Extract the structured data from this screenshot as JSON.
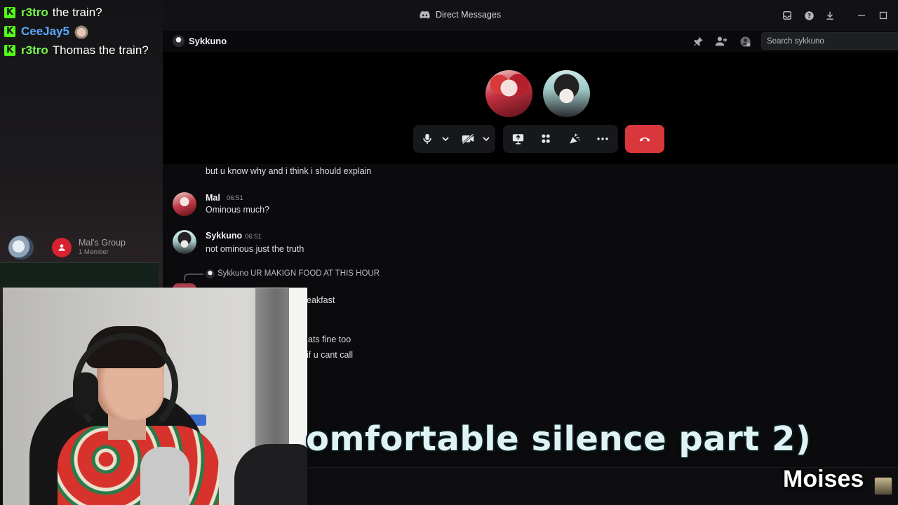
{
  "stream_chat": [
    {
      "badge": "K",
      "user": "r3tro",
      "user_color": "#75fb4c",
      "message": "the train?"
    },
    {
      "badge": "K",
      "user": "CeeJay5",
      "user_color": "#5aa8ff",
      "message": "",
      "emote": "cat-emote"
    },
    {
      "badge": "K",
      "user": "r3tro",
      "user_color": "#75fb4c",
      "message": "Thomas the train?"
    }
  ],
  "group": {
    "name": "Mal's Group",
    "members": "1 Member"
  },
  "window": {
    "title": "Direct Messages"
  },
  "dm_header": {
    "name": "Sykkuno",
    "search_placeholder": "Search sykkuno"
  },
  "icons": {
    "titlebar": [
      "inbox-icon",
      "help-icon",
      "download-icon",
      "minimize-icon",
      "maximize-icon"
    ],
    "header": [
      "pin-icon",
      "add-friend-icon",
      "profile-icon"
    ],
    "call": [
      "microphone-icon",
      "camera-off-icon",
      "screen-share-icon",
      "activity-icon",
      "soundboard-icon",
      "more-icon",
      "end-call-icon"
    ]
  },
  "colors": {
    "end_call": "#da373c",
    "kick_green": "#53fc18",
    "group_red": "#d6222e"
  },
  "messages": [
    {
      "text": "but u know why and i think i should explain"
    },
    {
      "author": "Mal",
      "time": "06:51",
      "text": "Ominous much?"
    },
    {
      "author": "Sykkuno",
      "time": "06:51",
      "text": "not ominous just the truth"
    },
    {
      "reply_author": "Sykkuno",
      "reply_text": "UR MAKIGN FOOD AT THIS HOUR"
    }
  ],
  "partial_messages": [
    "eakfast",
    "ats fine too",
    "if u cant call"
  ],
  "caption": "omfortable silence part 2)",
  "watermark": "Moises"
}
